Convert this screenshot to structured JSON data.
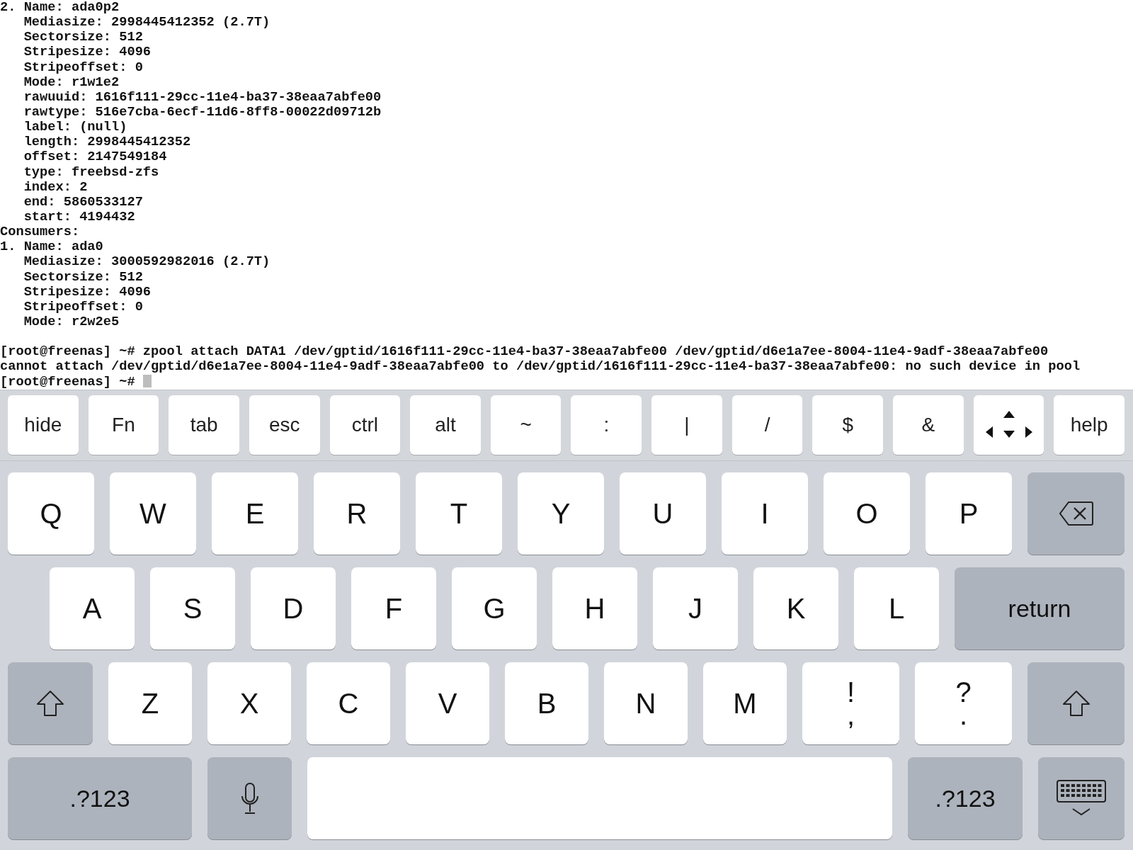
{
  "terminal": {
    "output": [
      "2. Name: ada0p2",
      "   Mediasize: 2998445412352 (2.7T)",
      "   Sectorsize: 512",
      "   Stripesize: 4096",
      "   Stripeoffset: 0",
      "   Mode: r1w1e2",
      "   rawuuid: 1616f111-29cc-11e4-ba37-38eaa7abfe00",
      "   rawtype: 516e7cba-6ecf-11d6-8ff8-00022d09712b",
      "   label: (null)",
      "   length: 2998445412352",
      "   offset: 2147549184",
      "   type: freebsd-zfs",
      "   index: 2",
      "   end: 5860533127",
      "   start: 4194432",
      "Consumers:",
      "1. Name: ada0",
      "   Mediasize: 3000592982016 (2.7T)",
      "   Sectorsize: 512",
      "   Stripesize: 4096",
      "   Stripeoffset: 0",
      "   Mode: r2w2e5"
    ],
    "session": [
      "[root@freenas] ~# zpool attach DATA1 /dev/gptid/1616f111-29cc-11e4-ba37-38eaa7abfe00 /dev/gptid/d6e1a7ee-8004-11e4-9adf-38eaa7abfe00",
      "cannot attach /dev/gptid/d6e1a7ee-8004-11e4-9adf-38eaa7abfe00 to /dev/gptid/1616f111-29cc-11e4-ba37-38eaa7abfe00: no such device in pool",
      "[root@freenas] ~# "
    ],
    "cursor_visible": true
  },
  "accessory_keys": [
    {
      "kind": "text",
      "label": "hide"
    },
    {
      "kind": "text",
      "label": "Fn"
    },
    {
      "kind": "text",
      "label": "tab"
    },
    {
      "kind": "text",
      "label": "esc"
    },
    {
      "kind": "text",
      "label": "ctrl"
    },
    {
      "kind": "text",
      "label": "alt"
    },
    {
      "kind": "text",
      "label": "~"
    },
    {
      "kind": "text",
      "label": ":"
    },
    {
      "kind": "text",
      "label": "|"
    },
    {
      "kind": "text",
      "label": "/"
    },
    {
      "kind": "text",
      "label": "$"
    },
    {
      "kind": "text",
      "label": "&"
    },
    {
      "kind": "arrows"
    },
    {
      "kind": "text",
      "label": "help"
    }
  ],
  "keyboard_rows": [
    [
      {
        "kind": "letter",
        "label": "Q"
      },
      {
        "kind": "letter",
        "label": "W"
      },
      {
        "kind": "letter",
        "label": "E"
      },
      {
        "kind": "letter",
        "label": "R"
      },
      {
        "kind": "letter",
        "label": "T"
      },
      {
        "kind": "letter",
        "label": "Y"
      },
      {
        "kind": "letter",
        "label": "U"
      },
      {
        "kind": "letter",
        "label": "I"
      },
      {
        "kind": "letter",
        "label": "O"
      },
      {
        "kind": "letter",
        "label": "P"
      },
      {
        "kind": "backspace"
      }
    ],
    [
      {
        "kind": "letter",
        "label": "A"
      },
      {
        "kind": "letter",
        "label": "S"
      },
      {
        "kind": "letter",
        "label": "D"
      },
      {
        "kind": "letter",
        "label": "F"
      },
      {
        "kind": "letter",
        "label": "G"
      },
      {
        "kind": "letter",
        "label": "H"
      },
      {
        "kind": "letter",
        "label": "J"
      },
      {
        "kind": "letter",
        "label": "K"
      },
      {
        "kind": "letter",
        "label": "L"
      },
      {
        "kind": "return",
        "label": "return"
      }
    ],
    [
      {
        "kind": "shift"
      },
      {
        "kind": "letter",
        "label": "Z"
      },
      {
        "kind": "letter",
        "label": "X"
      },
      {
        "kind": "letter",
        "label": "C"
      },
      {
        "kind": "letter",
        "label": "V"
      },
      {
        "kind": "letter",
        "label": "B"
      },
      {
        "kind": "letter",
        "label": "N"
      },
      {
        "kind": "letter",
        "label": "M"
      },
      {
        "kind": "dual",
        "top": "!",
        "bottom": ","
      },
      {
        "kind": "dual",
        "top": "?",
        "bottom": "."
      },
      {
        "kind": "shift"
      }
    ],
    [
      {
        "kind": "mode",
        "label": ".?123"
      },
      {
        "kind": "mic"
      },
      {
        "kind": "space"
      },
      {
        "kind": "mode",
        "label": ".?123"
      },
      {
        "kind": "dismiss"
      }
    ]
  ]
}
